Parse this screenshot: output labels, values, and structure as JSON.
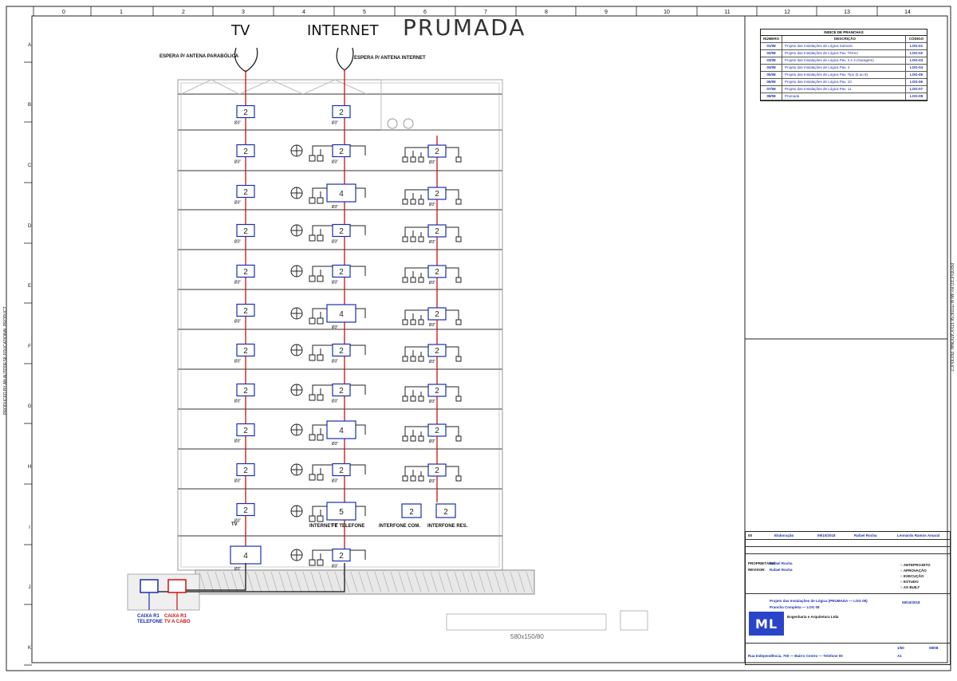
{
  "title": "PRUMADA",
  "columns": {
    "tv": "TV",
    "internet": "INTERNET"
  },
  "antennas": {
    "tv": "ESPERA P/ ANTENA PARABÓLICA",
    "internet": "ESPERA P/ ANTENA INTERNET"
  },
  "pipe_label": "Ø3\"",
  "tv_boxes": [
    "2",
    "2",
    "2",
    "2",
    "2",
    "2",
    "2",
    "2",
    "2",
    "2",
    "2",
    "4",
    "2"
  ],
  "internet_boxes": [
    "2",
    "2",
    "4",
    "2",
    "2",
    "4",
    "2",
    "2",
    "4",
    "2",
    "5",
    "2"
  ],
  "intercom_boxes": [
    "2",
    "2",
    "2",
    "2",
    "2",
    "2",
    "2",
    "2",
    "2",
    "2"
  ],
  "ground_labels": {
    "internet_phone": "INTERNET E TELEFONE",
    "interfone_com": "INTERFONE COM.",
    "interfone_res": "INTERFONE RES.",
    "caixa_telefone": "CAIXA R1\nTELEFONE",
    "caixa_tv": "CAIXA R1\nTV A CABO",
    "tv_ground": "TV"
  },
  "grid": {
    "top": [
      "0",
      "1",
      "2",
      "3",
      "4",
      "5",
      "6",
      "7",
      "8",
      "9",
      "10",
      "11",
      "12",
      "13",
      "14"
    ],
    "left": [
      "A",
      "B",
      "C",
      "D",
      "E",
      "F",
      "G",
      "H",
      "I",
      "J",
      "K"
    ]
  },
  "legend": {
    "header": "ÍNDICE DE PRANCHAS",
    "cols": [
      "NÚMERO",
      "DESCRIÇÃO",
      "CÓDIGO"
    ],
    "rows": [
      {
        "n": "01/08",
        "d": "Projeto das Instalações de Lógica Subsolo",
        "c": "LOG-01"
      },
      {
        "n": "02/08",
        "d": "Projeto das Instalações de Lógica Pav. Térreo",
        "c": "LOG-02"
      },
      {
        "n": "03/08",
        "d": "Projeto das Instalações de Lógica Pav. 2 e 3 (Garagem)",
        "c": "LOG-03"
      },
      {
        "n": "04/08",
        "d": "Projeto das Instalações de Lógica Pav. 4",
        "c": "LOG-04"
      },
      {
        "n": "05/08",
        "d": "Projeto das Instalações de Lógica Pav. Tipo (5 ao 9)",
        "c": "LOG-05"
      },
      {
        "n": "06/08",
        "d": "Projeto das Instalações de Lógica Pav. 10",
        "c": "LOG-06"
      },
      {
        "n": "07/08",
        "d": "Projeto das Instalações de Lógica Pav. 11",
        "c": "LOG-07"
      },
      {
        "n": "08/08",
        "d": "Prumada",
        "c": "LOG-08"
      }
    ]
  },
  "title_block": {
    "rev": "00",
    "rev_desc": "Elaboração",
    "rev_date": "09/10/2018",
    "author": "Rafael Rocha",
    "approver": "Leonardo Ramos Amaral",
    "owner": "Rafael Rocha",
    "reviewer": "Rafael Rocha",
    "stage_options": [
      "ANTEPROJETO",
      "APROVAÇÃO",
      "EXECUÇÃO",
      "ESTUDO",
      "AS BUILT"
    ],
    "subject": "Projeto das Instalações de Lógica (PRUMADA — LOG 08)",
    "subject2": "Prancha Completa — LOG 08",
    "date": "09/10/2018",
    "scale": "1/50",
    "sheet": "A1",
    "sheet_no": "08/08",
    "company": "Engenharia e Arquitetura Ltda",
    "address": "Rua Independência, 700 — Bairro Centro — Telefone 00",
    "logo": "ML"
  },
  "bottom_label": "580x150/80",
  "side_text": "PRODUCED BY AN AUTODESK EDUCATIONAL PRODUCT"
}
